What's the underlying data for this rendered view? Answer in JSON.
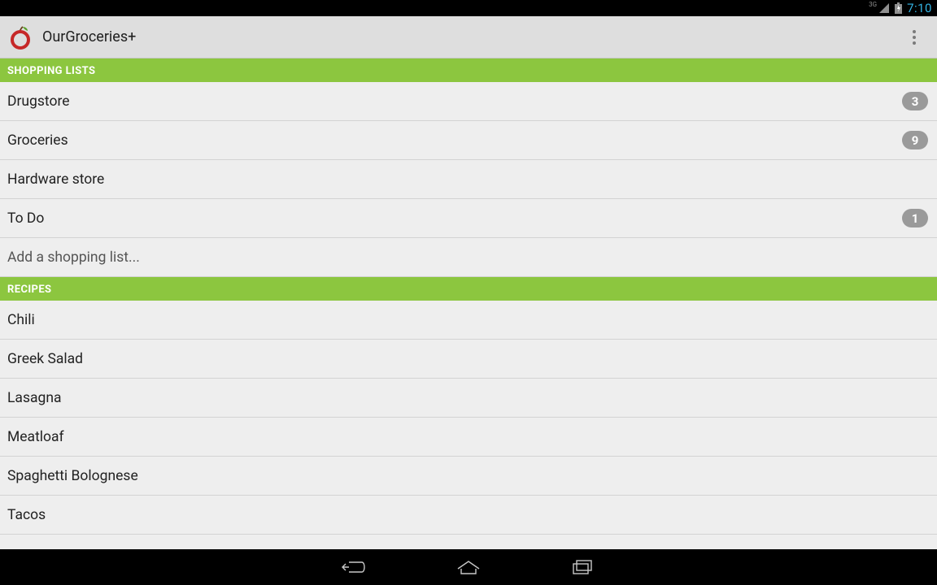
{
  "status": {
    "network_label": "3G",
    "clock": "7:10"
  },
  "header": {
    "title": "OurGroceries+"
  },
  "sections": {
    "shopping": {
      "header": "SHOPPING LISTS",
      "add_label": "Add a shopping list...",
      "items": [
        {
          "label": "Drugstore",
          "badge": "3"
        },
        {
          "label": "Groceries",
          "badge": "9"
        },
        {
          "label": "Hardware store",
          "badge": null
        },
        {
          "label": "To Do",
          "badge": "1"
        }
      ]
    },
    "recipes": {
      "header": "RECIPES",
      "items": [
        {
          "label": "Chili"
        },
        {
          "label": "Greek Salad"
        },
        {
          "label": "Lasagna"
        },
        {
          "label": "Meatloaf"
        },
        {
          "label": "Spaghetti Bolognese"
        },
        {
          "label": "Tacos"
        }
      ]
    }
  }
}
